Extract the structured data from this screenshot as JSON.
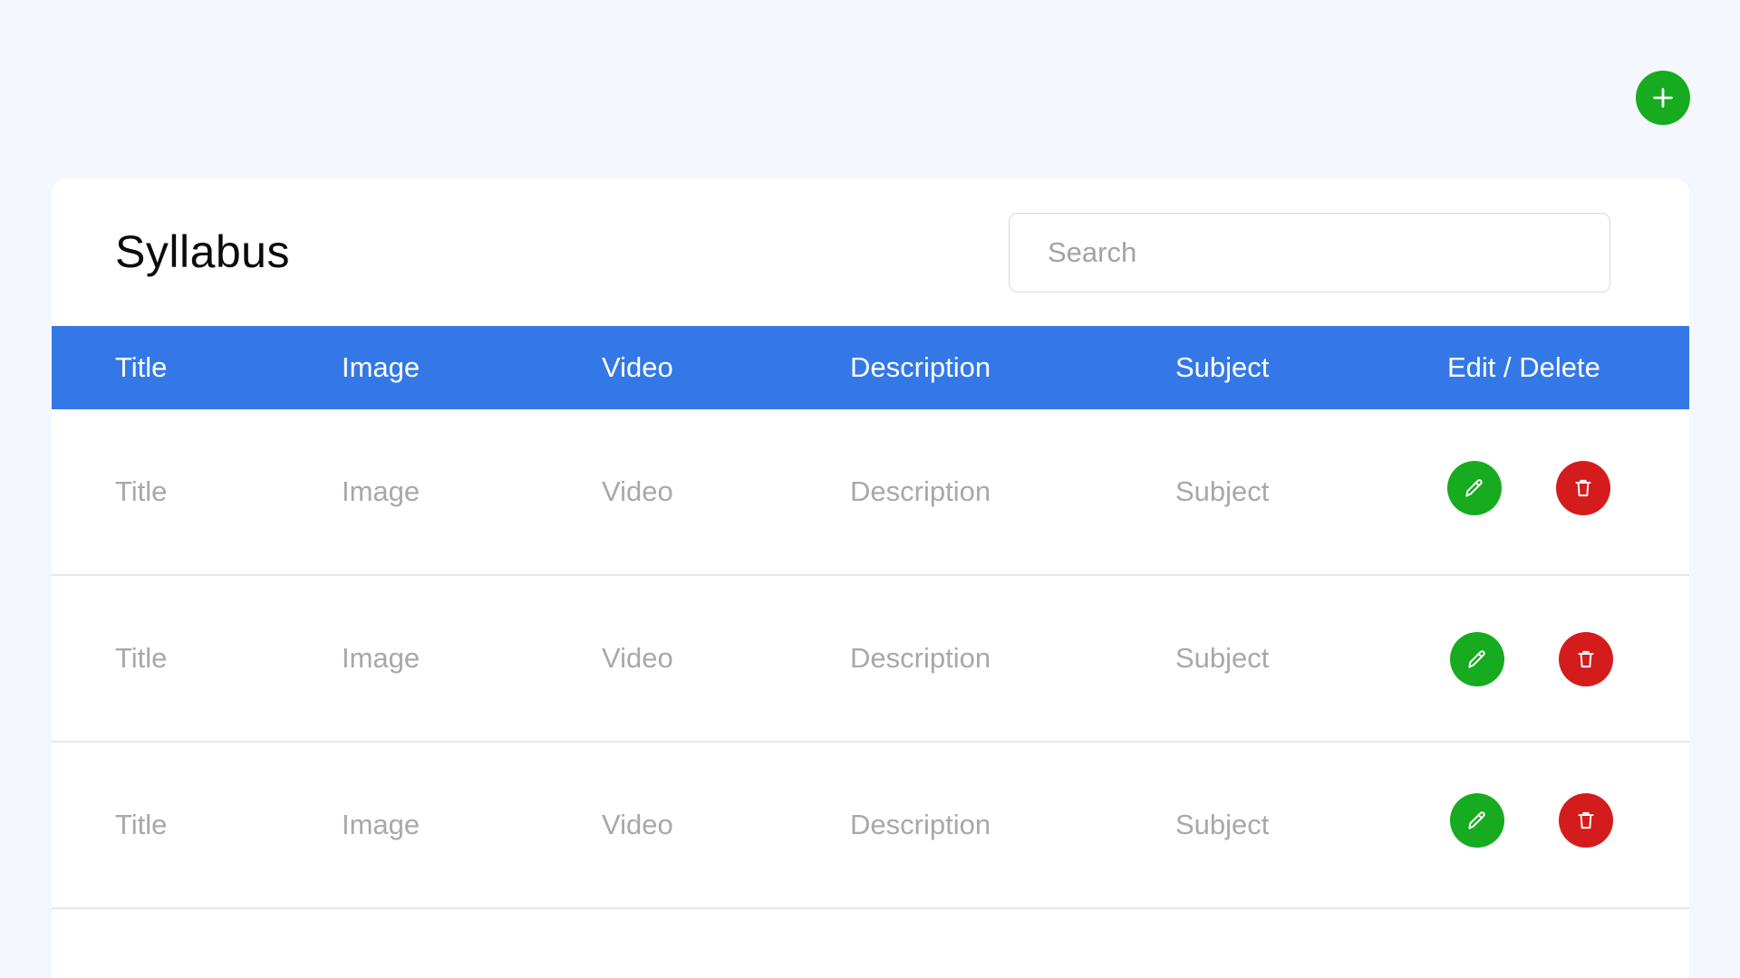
{
  "colors": {
    "primary_blue": "#3378e6",
    "success_green": "#17ab1f",
    "danger_red": "#d41c1c"
  },
  "header": {
    "title": "Syllabus",
    "search_placeholder": "Search",
    "add_icon": "plus-icon"
  },
  "table": {
    "columns": [
      "Title",
      "Image",
      "Video",
      "Description",
      "Subject",
      "Edit / Delete"
    ],
    "rows": [
      {
        "title": "Title",
        "image": "Image",
        "video": "Video",
        "description": "Description",
        "subject": "Subject"
      },
      {
        "title": "Title",
        "image": "Image",
        "video": "Video",
        "description": "Description",
        "subject": "Subject"
      },
      {
        "title": "Title",
        "image": "Image",
        "video": "Video",
        "description": "Description",
        "subject": "Subject"
      }
    ],
    "edit_icon": "pencil-icon",
    "delete_icon": "trash-icon"
  }
}
